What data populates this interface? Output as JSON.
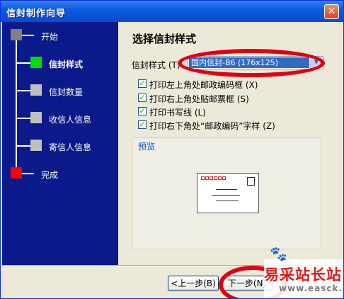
{
  "window": {
    "title": "信封制作向导",
    "close_symbol": "✕"
  },
  "steps": [
    {
      "label": "开始",
      "state": "done",
      "color": "#808080"
    },
    {
      "label": "信封样式",
      "state": "current",
      "color": "#00e000"
    },
    {
      "label": "信封数量",
      "state": "pending",
      "color": "#c0c0c0"
    },
    {
      "label": "收信人信息",
      "state": "pending",
      "color": "#c0c0c0"
    },
    {
      "label": "寄信人信息",
      "state": "pending",
      "color": "#c0c0c0"
    },
    {
      "label": "完成",
      "state": "end",
      "color": "#ff0000"
    }
  ],
  "main": {
    "page_title": "选择信封样式",
    "style_label": "信封样式 (T)",
    "style_value": "国内信封-B6 (176x125)",
    "options": [
      {
        "label": "打印左上角处邮政编码框 (X)",
        "checked": true
      },
      {
        "label": "打印右上角处贴邮票框 (S)",
        "checked": true
      },
      {
        "label": "打印书写线 (L)",
        "checked": true
      },
      {
        "label": "打印右下角处“邮政编码”字样 (Z)",
        "checked": true
      }
    ],
    "preview_label": "预览"
  },
  "buttons": {
    "back": "<上一步(B)",
    "next": "下一步(N)"
  },
  "watermark": {
    "title": "易采站长站",
    "url": "www.easck.com",
    "paw": "🐾"
  },
  "colors": {
    "titlebar": "#0a5ce0",
    "left_panel": "#0b1a8a",
    "annotation_red": "#e00010"
  }
}
